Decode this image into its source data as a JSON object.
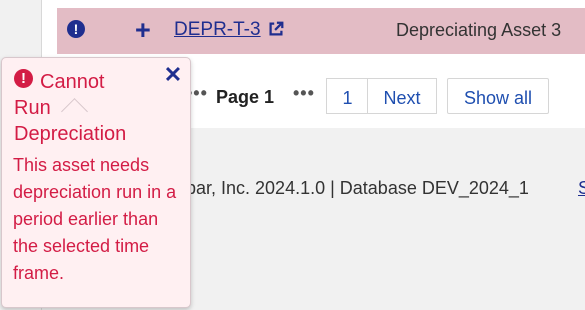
{
  "row": {
    "warning_icon": "exclamation-circle-icon",
    "expand_icon": "plus-icon",
    "asset_code": "DEPR-T-3",
    "external_icon": "external-link-icon",
    "description": "Depreciating Asset 3"
  },
  "pagination": {
    "previous_ellipsis": "•••",
    "current_page_label": "Page 1",
    "next_ellipsis": "•••",
    "page_button": "1",
    "next_label": "Next",
    "show_all_label": "Show all"
  },
  "footer": {
    "version_text": "bar, Inc.   2024.1.0 | Database DEV_2024_1",
    "partial_link": "S"
  },
  "popover": {
    "alert_icon": "exclamation-circle-icon",
    "title": "Cannot Run Depreciation",
    "close_icon": "close-icon",
    "message": "This asset needs depreciation run in a period earlier than the selected time frame."
  },
  "colors": {
    "row_background": "#e3bcc5",
    "popover_background": "#fff0f2",
    "popover_text": "#d31c45",
    "link": "#1f2e8f",
    "button_text": "#1f4fb0"
  }
}
